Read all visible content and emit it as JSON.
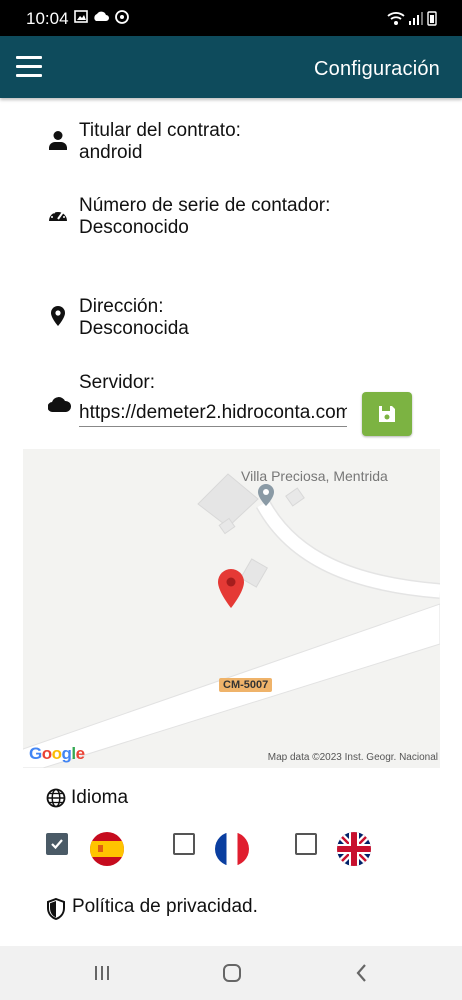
{
  "status_bar": {
    "time": "10:04"
  },
  "app_bar": {
    "title": "Configuración"
  },
  "contract": {
    "label": "Titular del contrato:",
    "value": "android"
  },
  "meter": {
    "label": "Número de serie de contador:",
    "value": "Desconocido"
  },
  "address": {
    "label": "Dirección:",
    "value": "Desconocida"
  },
  "server": {
    "label": "Servidor:",
    "value": "https://demeter2.hidroconta.com"
  },
  "map": {
    "place_name": "Villa Preciosa, Mentrida",
    "road_label": "CM-5007",
    "provider": "Google",
    "attribution": "Map data ©2023 Inst. Geogr. Nacional"
  },
  "language": {
    "title": "Idioma",
    "options": [
      {
        "code": "es",
        "icon": "spain-flag-icon",
        "checked": true
      },
      {
        "code": "fr",
        "icon": "france-flag-icon",
        "checked": false
      },
      {
        "code": "en",
        "icon": "uk-flag-icon",
        "checked": false
      }
    ]
  },
  "privacy": {
    "label": "Política de privacidad."
  },
  "colors": {
    "app_bar": "#0e4b5c",
    "save_button": "#7cb342",
    "status_bar": "#000000",
    "nav_bar": "#f1f1f1"
  }
}
